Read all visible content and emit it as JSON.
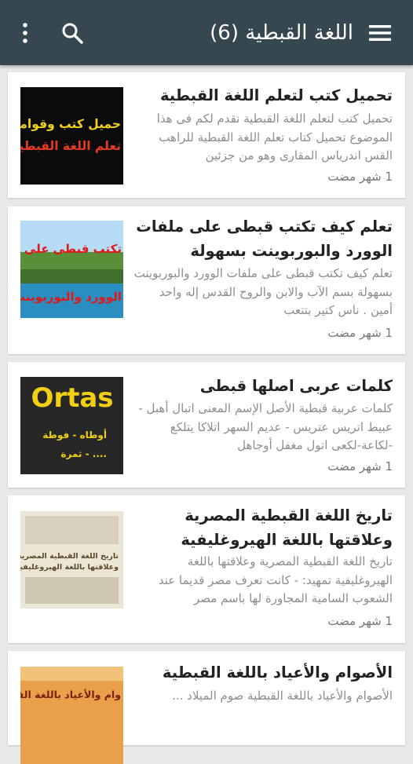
{
  "app_bar": {
    "title": "اللغة القبطية (6)",
    "menu_icon": "hamburger-menu-icon",
    "search_icon": "search-icon",
    "more_icon": "more-vertical-icon",
    "background_color": "#37474f"
  },
  "posts": [
    {
      "title": "تحميل كتب لتعلم اللغة القبطية",
      "excerpt": "تحميل كتب لتعلم اللغة القبطية نقدم لكم فى هذا الموضوع تحميل كتاب تعلم اللغة القبطية للراهب القس اندرياس المقارى وهو من جزئين",
      "time": "1 شهر مضت",
      "thumb_lines": [
        "حميل كتب وقواميس",
        "تعلم اللغة القبطية"
      ]
    },
    {
      "title": "تعلم كيف تكتب قبطى على ملفات الوورد والبوربوينت بسهولة",
      "excerpt": "تعلم كيف تكتب قبطى على ملفات الوورد والبوربوينت بسهولة بسم الآب والابن والروح القدس إله واحد أمين . ناس كتير بتتعب",
      "time": "1 شهر مضت",
      "thumb_lines": [
        "تكتب قبطى على م",
        "الوورد والبوربوينت"
      ]
    },
    {
      "title": "كلمات عربى اصلها قبطى",
      "excerpt": "كلمات عربية قبطية الأصل الإسم المعنى اتبال أهبل - عبيط اتريس عتريس - عديم السهر اتلاكا يتلكع -لكاعة-لكعى اتول مغفل أوجاهل",
      "time": "1 شهر مضت",
      "thumb_lines": [
        "Ortas",
        "أوطاه - فوطة",
        "ثمرة - ...."
      ]
    },
    {
      "title": "تاريخ اللغة القبطية المصرية وعلاقتها باللغة الهيروغليفية",
      "excerpt": "تاريخ اللغة القبطية المصرية وعلاقتها باللغة الهيروغليفية تمهيد: - كانت تعرف مصر قديما عند الشعوب السامية المجاورة لها باسم مصر",
      "time": "1 شهر مضت",
      "thumb_lines": [
        "تاريخ اللغة القبطية المصرية",
        "وعلاقتها باللغة الهيروغليفية"
      ]
    },
    {
      "title": "الأصوام والأعياد باللغة القبطية",
      "excerpt": "الأصوام والأعياد باللغة القبطية صوم الميلاد ...",
      "time": "",
      "thumb_lines": [
        "وام والأعياد باللغة القب"
      ]
    }
  ]
}
